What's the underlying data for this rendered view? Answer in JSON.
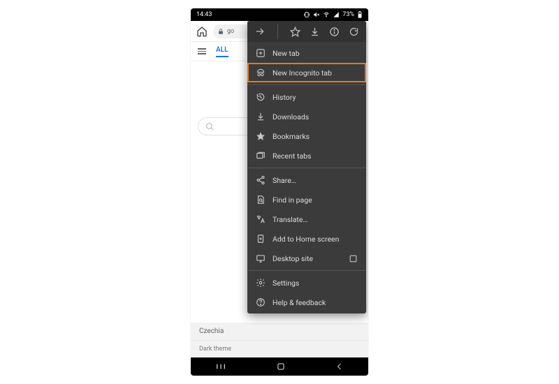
{
  "status": {
    "time": "14:43",
    "battery": "73%"
  },
  "toolbar": {
    "url_prefix": "go"
  },
  "tabs": {
    "all": "ALL"
  },
  "footer": {
    "country": "Czechia",
    "theme": "Dark theme"
  },
  "menu": {
    "items": [
      {
        "id": "new-tab",
        "label": "New tab"
      },
      {
        "id": "incognito",
        "label": "New Incognito tab",
        "highlight": true
      },
      {
        "id": "history",
        "label": "History"
      },
      {
        "id": "downloads",
        "label": "Downloads"
      },
      {
        "id": "bookmarks",
        "label": "Bookmarks"
      },
      {
        "id": "recent-tabs",
        "label": "Recent tabs"
      },
      {
        "id": "share",
        "label": "Share…"
      },
      {
        "id": "find-in-page",
        "label": "Find in page"
      },
      {
        "id": "translate",
        "label": "Translate…"
      },
      {
        "id": "add-home",
        "label": "Add to Home screen"
      },
      {
        "id": "desktop-site",
        "label": "Desktop site",
        "checkbox": true
      },
      {
        "id": "settings",
        "label": "Settings"
      },
      {
        "id": "help",
        "label": "Help & feedback"
      }
    ]
  }
}
